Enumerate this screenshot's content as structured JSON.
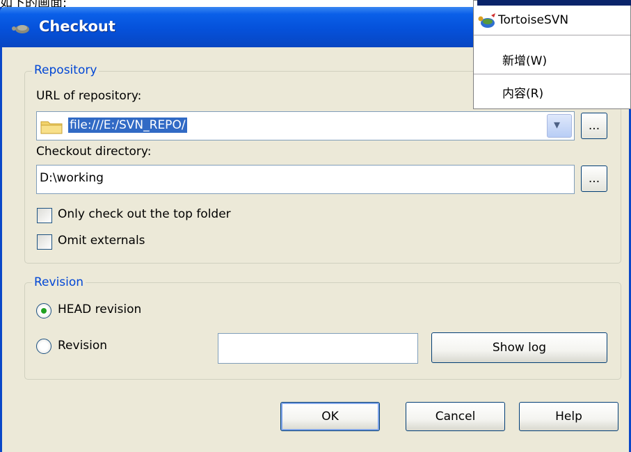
{
  "caption_fragment": "如下的画面:",
  "window": {
    "title": "Checkout"
  },
  "context_menu": {
    "items": [
      {
        "label": "TortoiseSVN"
      },
      {
        "label": "新增(W)"
      },
      {
        "label": "内容(R)"
      }
    ]
  },
  "repository": {
    "group_title": "Repository",
    "url_label": "URL of repository:",
    "url_value": "file:///E:/SVN_REPO/",
    "browse_label": "...",
    "dir_label": "Checkout directory:",
    "dir_value": "D:\\working",
    "only_top_label": "Only check out the top folder",
    "only_top_checked": false,
    "omit_externals_label": "Omit externals",
    "omit_externals_checked": false
  },
  "revision": {
    "group_title": "Revision",
    "head_label": "HEAD revision",
    "head_selected": true,
    "revision_label": "Revision",
    "revision_value": "",
    "show_log_label": "Show log"
  },
  "buttons": {
    "ok": "OK",
    "cancel": "Cancel",
    "help": "Help"
  },
  "colors": {
    "titlebar": "#0551da",
    "dialog_bg": "#ece9d8",
    "selection": "#316ac5",
    "group_title": "#0046d5"
  }
}
